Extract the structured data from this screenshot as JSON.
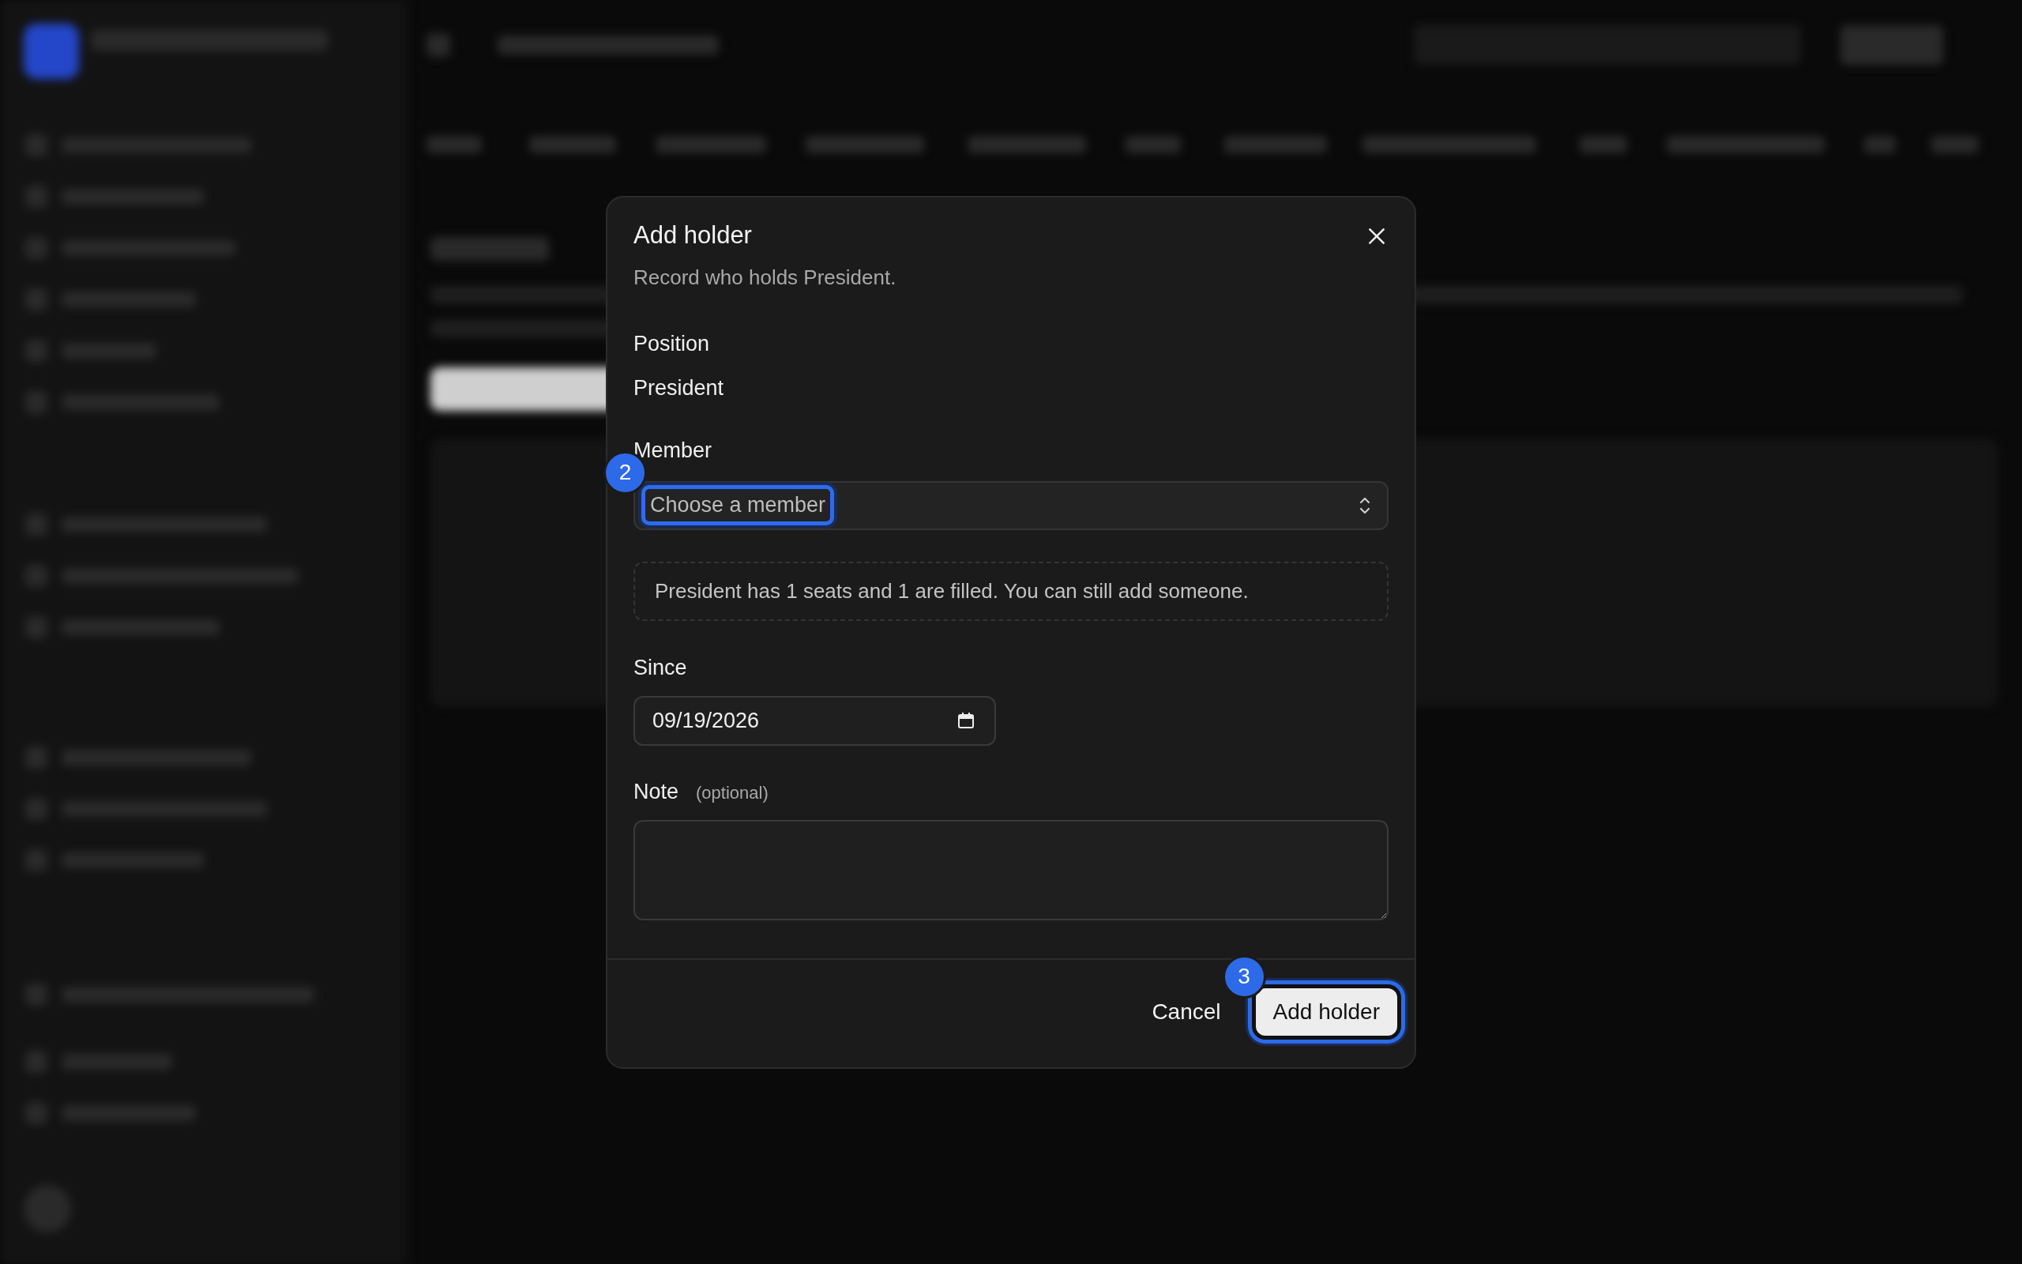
{
  "dialog": {
    "title": "Add holder",
    "subtitle": "Record who holds President.",
    "position": {
      "label": "Position",
      "value": "President"
    },
    "member": {
      "label": "Member",
      "placeholder": "Choose a member",
      "highlighted": true,
      "marker": "2"
    },
    "notice": "President has 1 seats and 1 are filled. You can still add someone.",
    "since": {
      "label": "Since",
      "value": "09/19/2026"
    },
    "note": {
      "label": "Note",
      "hint": "(optional)"
    },
    "buttons": [
      {
        "label": "Cancel",
        "kind": "secondary",
        "highlighted": false
      },
      {
        "label": "Add holder",
        "kind": "primary",
        "highlighted": true,
        "marker": "3"
      }
    ]
  }
}
